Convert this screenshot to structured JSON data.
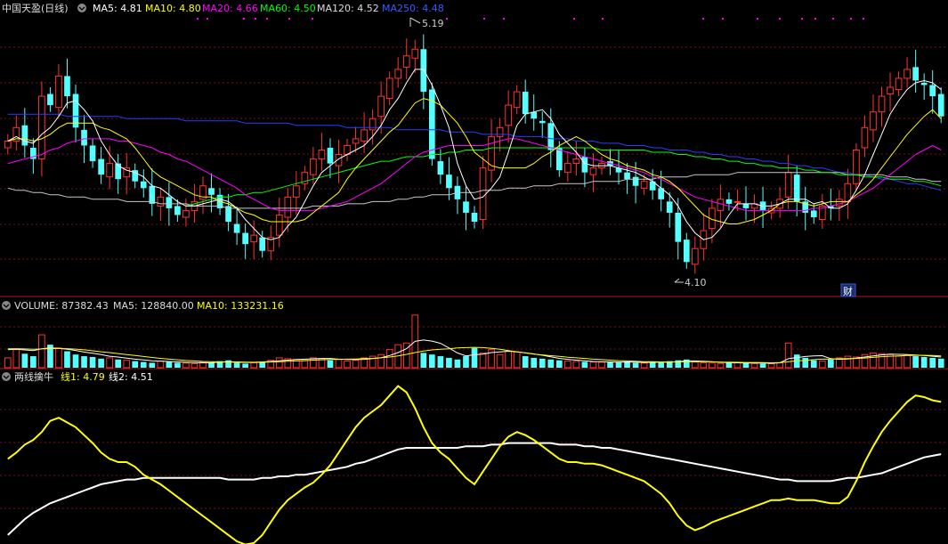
{
  "colors": {
    "up": "#ff3232",
    "down": "#54ffff",
    "ma5": "#ffffff",
    "ma10": "#ffff00",
    "ma20": "#ff00ff",
    "ma60": "#00ff00",
    "ma120": "#c8c8c8",
    "ma250": "#2a3dff",
    "grid": "#7a1010",
    "divider": "#b01818",
    "label": "#dddddd"
  },
  "icons": {
    "collapse": "chevron-down-circle-icon",
    "finance_badge": "finance-badge"
  },
  "header": {
    "stock_name": "中国天盈(日线)",
    "ma5_label": "MA5: 4.81",
    "ma10_label": "MA10: 4.80",
    "ma20_label": "MA20: 4.66",
    "ma60_label": "MA60: 4.50",
    "ma120_label": "MA120: 4.52",
    "ma250_label": "MA250: 4.48"
  },
  "annotations": {
    "high_label": "5.19",
    "low_label": "4.10",
    "finance_badge": "财"
  },
  "volume_header": {
    "volume_label": "VOLUME: 87382.43",
    "ma5_label": "MA5: 128840.00",
    "ma10_label": "MA10: 133231.16"
  },
  "indicator_header": {
    "name": "两线擒牛",
    "line1_label": "线1: 4.79",
    "line2_label": "线2: 4.51"
  },
  "chart_data": {
    "type": "candlestick",
    "price_range": [
      4.05,
      5.25
    ],
    "last_values": {
      "MA5": 4.81,
      "MA10": 4.8,
      "MA20": 4.66,
      "MA60": 4.5,
      "MA120": 4.52,
      "MA250": 4.48
    },
    "price_series": {
      "close": [
        4.7,
        4.76,
        4.68,
        4.62,
        4.9,
        4.86,
        4.99,
        4.9,
        4.76,
        4.68,
        4.61,
        4.55,
        4.6,
        4.53,
        4.58,
        4.52,
        4.49,
        4.42,
        4.45,
        4.4,
        4.37,
        4.39,
        4.43,
        4.5,
        4.46,
        4.4,
        4.34,
        4.29,
        4.24,
        4.28,
        4.21,
        4.27,
        4.37,
        4.45,
        4.5,
        4.56,
        4.62,
        4.66,
        4.6,
        4.64,
        4.68,
        4.71,
        4.75,
        4.8,
        4.9,
        4.98,
        5.02,
        5.08,
        5.11,
        4.92,
        4.62,
        4.55,
        4.49,
        4.44,
        4.38,
        4.34,
        4.58,
        4.72,
        4.76,
        4.86,
        4.92,
        4.82,
        4.8,
        4.78,
        4.66,
        4.57,
        4.6,
        4.62,
        4.56,
        4.58,
        4.6,
        4.59,
        4.56,
        4.53,
        4.5,
        4.52,
        4.48,
        4.44,
        4.38,
        4.25,
        4.16,
        4.22,
        4.3,
        4.4,
        4.44,
        4.42,
        4.43,
        4.4,
        4.42,
        4.39,
        4.4,
        4.44,
        4.56,
        4.43,
        4.38,
        4.36,
        4.41,
        4.4,
        4.44,
        4.51,
        4.66,
        4.76,
        4.83,
        4.9,
        4.94,
        4.98,
        5.02,
        4.97,
        4.95,
        4.9,
        4.81
      ],
      "MA5": [
        4.7,
        4.72,
        4.7,
        4.69,
        4.73,
        4.76,
        4.81,
        4.87,
        4.88,
        4.84,
        4.79,
        4.7,
        4.64,
        4.59,
        4.57,
        4.56,
        4.54,
        4.5,
        4.49,
        4.46,
        4.43,
        4.41,
        4.41,
        4.42,
        4.43,
        4.44,
        4.43,
        4.4,
        4.35,
        4.31,
        4.27,
        4.26,
        4.27,
        4.32,
        4.36,
        4.43,
        4.5,
        4.56,
        4.59,
        4.62,
        4.64,
        4.66,
        4.68,
        4.72,
        4.77,
        4.84,
        4.89,
        4.96,
        5.02,
        5.02,
        4.95,
        4.86,
        4.76,
        4.6,
        4.5,
        4.44,
        4.45,
        4.49,
        4.54,
        4.65,
        4.77,
        4.82,
        4.83,
        4.84,
        4.8,
        4.73,
        4.69,
        4.65,
        4.6,
        4.59,
        4.59,
        4.59,
        4.58,
        4.57,
        4.56,
        4.54,
        4.52,
        4.49,
        4.46,
        4.41,
        4.34,
        4.29,
        4.26,
        4.27,
        4.31,
        4.37,
        4.42,
        4.42,
        4.42,
        4.41,
        4.41,
        4.42,
        4.44,
        4.44,
        4.44,
        4.42,
        4.43,
        4.4,
        4.4,
        4.42,
        4.48,
        4.55,
        4.64,
        4.73,
        4.82,
        4.88,
        4.93,
        4.96,
        4.97,
        4.96,
        4.93
      ],
      "MA10": [
        4.7,
        4.71,
        4.71,
        4.7,
        4.71,
        4.73,
        4.76,
        4.78,
        4.78,
        4.78,
        4.78,
        4.76,
        4.75,
        4.73,
        4.71,
        4.67,
        4.62,
        4.57,
        4.54,
        4.52,
        4.5,
        4.48,
        4.46,
        4.45,
        4.45,
        4.43,
        4.42,
        4.4,
        4.38,
        4.37,
        4.35,
        4.34,
        4.34,
        4.34,
        4.34,
        4.35,
        4.38,
        4.41,
        4.44,
        4.47,
        4.53,
        4.58,
        4.62,
        4.66,
        4.7,
        4.74,
        4.77,
        4.82,
        4.87,
        4.89,
        4.88,
        4.86,
        4.82,
        4.78,
        4.72,
        4.65,
        4.62,
        4.59,
        4.58,
        4.58,
        4.58,
        4.58,
        4.6,
        4.63,
        4.65,
        4.68,
        4.7,
        4.72,
        4.7,
        4.67,
        4.64,
        4.62,
        4.61,
        4.59,
        4.58,
        4.57,
        4.55,
        4.54,
        4.52,
        4.49,
        4.45,
        4.41,
        4.37,
        4.35,
        4.34,
        4.33,
        4.33,
        4.34,
        4.35,
        4.37,
        4.39,
        4.42,
        4.43,
        4.43,
        4.42,
        4.41,
        4.42,
        4.43,
        4.43,
        4.43,
        4.46,
        4.49,
        4.53,
        4.58,
        4.63,
        4.68,
        4.73,
        4.77,
        4.81,
        4.84,
        4.8
      ],
      "MA20": [
        4.6,
        4.61,
        4.62,
        4.63,
        4.64,
        4.66,
        4.67,
        4.69,
        4.7,
        4.71,
        4.71,
        4.71,
        4.71,
        4.7,
        4.7,
        4.69,
        4.68,
        4.67,
        4.65,
        4.64,
        4.62,
        4.61,
        4.59,
        4.57,
        4.55,
        4.53,
        4.51,
        4.49,
        4.46,
        4.44,
        4.42,
        4.4,
        4.39,
        4.39,
        4.39,
        4.39,
        4.39,
        4.4,
        4.41,
        4.42,
        4.43,
        4.45,
        4.47,
        4.49,
        4.51,
        4.54,
        4.57,
        4.6,
        4.63,
        4.65,
        4.66,
        4.67,
        4.68,
        4.68,
        4.68,
        4.68,
        4.68,
        4.69,
        4.7,
        4.71,
        4.71,
        4.7,
        4.69,
        4.68,
        4.67,
        4.66,
        4.65,
        4.64,
        4.63,
        4.62,
        4.61,
        4.6,
        4.59,
        4.58,
        4.57,
        4.56,
        4.54,
        4.53,
        4.51,
        4.49,
        4.47,
        4.45,
        4.44,
        4.43,
        4.42,
        4.41,
        4.4,
        4.39,
        4.39,
        4.39,
        4.39,
        4.39,
        4.39,
        4.39,
        4.39,
        4.4,
        4.4,
        4.41,
        4.42,
        4.43,
        4.45,
        4.47,
        4.49,
        4.52,
        4.55,
        4.58,
        4.61,
        4.64,
        4.66,
        4.68,
        4.66
      ],
      "MA60": [
        4.28,
        null,
        null,
        null,
        4.3,
        null,
        null,
        null,
        null,
        null,
        null,
        null,
        null,
        null,
        null,
        null,
        null,
        null,
        null,
        null,
        null,
        4.41,
        4.42,
        4.43,
        4.44,
        4.45,
        4.45,
        4.46,
        4.46,
        4.47,
        4.47,
        4.48,
        4.49,
        4.5,
        4.51,
        4.52,
        4.53,
        4.54,
        4.55,
        4.56,
        4.57,
        4.58,
        4.59,
        4.6,
        4.61,
        4.61,
        4.62,
        4.63,
        4.63,
        4.63,
        4.64,
        4.64,
        4.65,
        4.65,
        4.66,
        4.66,
        4.66,
        4.67,
        4.67,
        4.67,
        4.67,
        4.67,
        4.67,
        4.67,
        4.67,
        4.67,
        4.67,
        4.67,
        4.67,
        4.67,
        4.66,
        4.66,
        4.66,
        4.66,
        4.66,
        4.66,
        4.65,
        4.65,
        4.65,
        4.64,
        4.64,
        4.63,
        4.63,
        4.62,
        4.62,
        4.61,
        4.61,
        4.6,
        4.6,
        4.59,
        4.59,
        4.58,
        4.58,
        4.58,
        4.57,
        4.57,
        4.56,
        4.56,
        4.55,
        4.55,
        4.55,
        4.54,
        4.54,
        4.54,
        4.53,
        4.53,
        4.53,
        4.52,
        4.52,
        4.51,
        4.5
      ],
      "MA120": [
        4.49,
        4.48,
        4.48,
        4.47,
        4.47,
        4.46,
        4.46,
        4.45,
        4.45,
        4.45,
        4.44,
        4.44,
        4.44,
        4.44,
        4.43,
        4.43,
        4.43,
        4.43,
        4.42,
        4.42,
        4.42,
        4.42,
        4.41,
        4.41,
        4.41,
        4.41,
        4.4,
        4.4,
        4.4,
        4.4,
        4.4,
        4.4,
        4.4,
        4.4,
        4.4,
        4.4,
        4.41,
        4.41,
        4.41,
        4.41,
        4.42,
        4.42,
        4.42,
        4.43,
        4.43,
        4.43,
        4.44,
        4.44,
        4.45,
        4.45,
        4.46,
        4.46,
        4.46,
        4.47,
        4.47,
        4.47,
        4.48,
        4.48,
        4.48,
        4.49,
        4.49,
        4.49,
        4.5,
        4.5,
        4.5,
        4.51,
        4.51,
        4.51,
        4.51,
        4.52,
        4.52,
        4.52,
        4.52,
        4.53,
        4.53,
        4.53,
        4.53,
        4.54,
        4.54,
        4.54,
        4.54,
        4.55,
        4.55,
        4.55,
        4.55,
        4.55,
        4.56,
        4.56,
        4.56,
        4.56,
        4.56,
        4.56,
        4.56,
        4.56,
        4.56,
        4.56,
        4.56,
        4.56,
        4.56,
        4.55,
        4.55,
        4.55,
        4.55,
        4.55,
        4.54,
        4.54,
        4.54,
        4.53,
        4.53,
        4.52,
        4.52
      ],
      "MA250": [
        4.82,
        4.82,
        4.82,
        4.82,
        4.82,
        4.82,
        4.82,
        4.81,
        4.81,
        4.81,
        4.81,
        4.81,
        4.81,
        4.81,
        4.8,
        4.8,
        4.8,
        4.8,
        4.8,
        4.8,
        4.8,
        4.79,
        4.79,
        4.79,
        4.79,
        4.79,
        4.79,
        4.79,
        4.78,
        4.78,
        4.78,
        4.78,
        4.78,
        4.78,
        4.77,
        4.77,
        4.77,
        4.77,
        4.77,
        4.77,
        4.76,
        4.76,
        4.76,
        4.76,
        4.76,
        4.76,
        4.75,
        4.75,
        4.75,
        4.75,
        4.75,
        4.75,
        4.74,
        4.74,
        4.74,
        4.74,
        4.73,
        4.73,
        4.73,
        4.73,
        4.72,
        4.72,
        4.72,
        4.72,
        4.71,
        4.71,
        4.71,
        4.7,
        4.7,
        4.7,
        4.69,
        4.69,
        4.69,
        4.68,
        4.68,
        4.68,
        4.67,
        4.67,
        4.66,
        4.66,
        4.66,
        4.65,
        4.65,
        4.64,
        4.64,
        4.63,
        4.63,
        4.62,
        4.62,
        4.61,
        4.61,
        4.6,
        4.6,
        4.59,
        4.59,
        4.58,
        4.58,
        4.57,
        4.56,
        4.56,
        4.55,
        4.55,
        4.54,
        4.53,
        4.53,
        4.52,
        4.51,
        4.51,
        4.5,
        4.49,
        4.48
      ]
    },
    "volume_series": {
      "volume": [
        60,
        110,
        85,
        70,
        200,
        140,
        120,
        100,
        80,
        70,
        65,
        55,
        60,
        50,
        45,
        40,
        35,
        30,
        40,
        35,
        30,
        28,
        25,
        35,
        30,
        40,
        45,
        30,
        25,
        30,
        35,
        45,
        60,
        55,
        50,
        45,
        60,
        55,
        45,
        50,
        40,
        45,
        60,
        70,
        80,
        110,
        140,
        150,
        320,
        90,
        80,
        70,
        60,
        50,
        70,
        120,
        90,
        110,
        80,
        100,
        95,
        70,
        60,
        55,
        50,
        45,
        40,
        38,
        36,
        35,
        34,
        33,
        32,
        38,
        30,
        28,
        35,
        30,
        40,
        45,
        50,
        35,
        30,
        28,
        26,
        30,
        32,
        28,
        26,
        25,
        24,
        30,
        150,
        80,
        60,
        45,
        40,
        50,
        60,
        70,
        65,
        80,
        90,
        85,
        80,
        70,
        75,
        70,
        65,
        60,
        55
      ],
      "MA5": [
        110,
        112,
        108,
        104,
        115,
        120,
        118,
        112,
        105,
        95,
        88,
        80,
        70,
        65,
        58,
        52,
        47,
        42,
        40,
        38,
        35,
        33,
        31,
        30,
        31,
        34,
        36,
        35,
        34,
        33,
        35,
        38,
        42,
        46,
        50,
        52,
        54,
        56,
        56,
        52,
        50,
        49,
        51,
        55,
        61,
        74,
        92,
        116,
        160,
        168,
        162,
        148,
        120,
        90,
        72,
        79,
        82,
        92,
        96,
        100,
        97,
        91,
        84,
        76,
        66,
        57,
        51,
        46,
        42,
        38,
        36,
        35,
        34,
        34,
        34,
        32,
        33,
        33,
        34,
        37,
        41,
        41,
        39,
        36,
        33,
        31,
        30,
        29,
        28,
        28,
        27,
        30,
        55,
        61,
        68,
        72,
        73,
        55,
        51,
        53,
        58,
        65,
        72,
        78,
        82,
        81,
        80,
        77,
        74,
        70,
        65
      ],
      "MA10": [
        115,
        116,
        114,
        112,
        114,
        116,
        117,
        116,
        113,
        109,
        103,
        97,
        92,
        86,
        80,
        74,
        68,
        62,
        57,
        52,
        48,
        44,
        41,
        38,
        36,
        35,
        34,
        33,
        32,
        32,
        33,
        35,
        37,
        39,
        41,
        43,
        46,
        48,
        50,
        51,
        52,
        53,
        55,
        57,
        60,
        65,
        72,
        81,
        92,
        101,
        108,
        112,
        115,
        120,
        122,
        124,
        122,
        118,
        112,
        104,
        97,
        90,
        83,
        78,
        73,
        69,
        64,
        60,
        56,
        52,
        49,
        46,
        43,
        41,
        39,
        37,
        36,
        35,
        35,
        35,
        36,
        36,
        36,
        35,
        34,
        34,
        33,
        32,
        32,
        31,
        30,
        31,
        37,
        41,
        45,
        49,
        52,
        53,
        54,
        55,
        56,
        59,
        63,
        67,
        70,
        72,
        74,
        75,
        75,
        74,
        72
      ]
    },
    "indicator_series": {
      "line1": [
        4.88,
        4.92,
        4.97,
        5.0,
        5.05,
        5.12,
        5.14,
        5.11,
        5.08,
        5.03,
        4.98,
        4.92,
        4.88,
        4.86,
        4.86,
        4.83,
        4.78,
        4.75,
        4.72,
        4.68,
        4.64,
        4.6,
        4.56,
        4.52,
        4.48,
        4.44,
        4.4,
        4.36,
        4.34,
        4.35,
        4.4,
        4.48,
        4.56,
        4.62,
        4.66,
        4.7,
        4.73,
        4.78,
        4.84,
        4.92,
        5.0,
        5.08,
        5.14,
        5.18,
        5.22,
        5.28,
        5.34,
        5.3,
        5.2,
        5.08,
        4.98,
        4.92,
        4.88,
        4.82,
        4.76,
        4.72,
        4.8,
        4.88,
        4.96,
        5.02,
        5.05,
        5.03,
        5.0,
        4.96,
        4.92,
        4.88,
        4.86,
        4.86,
        4.85,
        4.85,
        4.84,
        4.82,
        4.8,
        4.78,
        4.76,
        4.74,
        4.7,
        4.66,
        4.6,
        4.52,
        4.46,
        4.43,
        4.45,
        4.48,
        4.5,
        4.52,
        4.54,
        4.56,
        4.58,
        4.6,
        4.62,
        4.62,
        4.63,
        4.62,
        4.62,
        4.62,
        4.61,
        4.6,
        4.6,
        4.64,
        4.74,
        4.86,
        4.96,
        5.05,
        5.12,
        5.18,
        5.24,
        5.28,
        5.27,
        5.25,
        5.24
      ],
      "line2": [
        4.4,
        4.45,
        4.5,
        4.54,
        4.57,
        4.6,
        4.62,
        4.64,
        4.66,
        4.68,
        4.7,
        4.72,
        4.73,
        4.74,
        4.75,
        4.75,
        4.76,
        4.76,
        4.76,
        4.76,
        4.76,
        4.76,
        4.76,
        4.76,
        4.76,
        4.76,
        4.75,
        4.75,
        4.75,
        4.75,
        4.76,
        4.76,
        4.77,
        4.77,
        4.78,
        4.78,
        4.79,
        4.8,
        4.81,
        4.82,
        4.83,
        4.85,
        4.86,
        4.88,
        4.9,
        4.92,
        4.94,
        4.95,
        4.95,
        4.95,
        4.95,
        4.95,
        4.95,
        4.95,
        4.96,
        4.96,
        4.96,
        4.97,
        4.97,
        4.98,
        4.98,
        4.98,
        4.98,
        4.98,
        4.98,
        4.97,
        4.97,
        4.97,
        4.96,
        4.96,
        4.95,
        4.95,
        4.94,
        4.93,
        4.92,
        4.91,
        4.9,
        4.89,
        4.88,
        4.87,
        4.86,
        4.85,
        4.84,
        4.83,
        4.82,
        4.81,
        4.8,
        4.79,
        4.78,
        4.77,
        4.76,
        4.75,
        4.75,
        4.74,
        4.74,
        4.74,
        4.74,
        4.74,
        4.75,
        4.76,
        4.76,
        4.77,
        4.78,
        4.79,
        4.81,
        4.83,
        4.85,
        4.87,
        4.89,
        4.9,
        4.91
      ],
      "range": [
        4.36,
        5.36
      ]
    }
  }
}
